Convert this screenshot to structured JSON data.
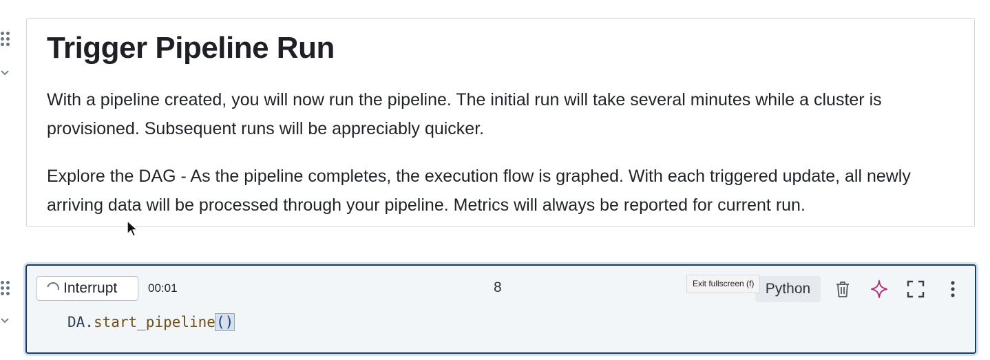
{
  "markdown_cell": {
    "title": "Trigger Pipeline Run",
    "paragraph_1": "With a pipeline created, you will now run the pipeline. The initial run will take several minutes while a cluster is provisioned. Subsequent runs will be appreciably quicker.",
    "paragraph_2": "Explore the DAG - As the pipeline completes, the execution flow is graphed. With each triggered update, all newly arriving data will be processed through your pipeline. Metrics will always be reported for current run."
  },
  "code_cell": {
    "interrupt_label": "Interrupt",
    "elapsed": "00:01",
    "execution_count": "8",
    "tooltip": "Exit fullscreen (f)",
    "language": "Python",
    "code": {
      "object": "DA.",
      "function": "start_pipeline",
      "parens": "()"
    },
    "icons": [
      "delete-icon",
      "assistant-sparkle-icon",
      "fullscreen-icon",
      "more-options-icon"
    ]
  },
  "colors": {
    "active_cell_border": "#1b3a5c",
    "assistant_sparkle": "#b0307a"
  }
}
